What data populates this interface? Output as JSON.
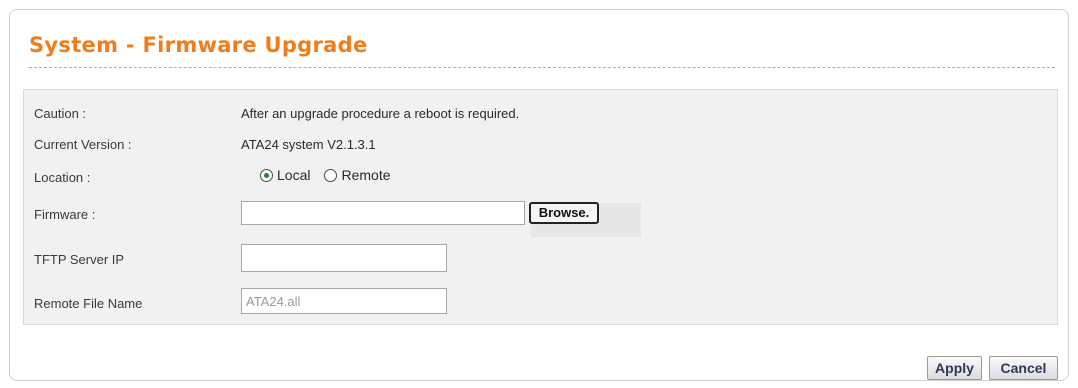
{
  "page": {
    "title": "System - Firmware Upgrade"
  },
  "form": {
    "caution_label": "Caution :",
    "caution_text": "After an upgrade procedure a reboot is required.",
    "current_version_label": "Current Version :",
    "current_version_value": "ATA24 system V2.1.3.1",
    "location_label": "Location :",
    "location_options": [
      {
        "label": "Local",
        "selected": true
      },
      {
        "label": "Remote",
        "selected": false
      }
    ],
    "firmware_label": "Firmware :",
    "firmware_value": "",
    "browse_label": "Browse.",
    "tftp_label": "TFTP Server IP",
    "tftp_value": "",
    "remote_file_label": "Remote File Name",
    "remote_file_value": "ATA24.all"
  },
  "actions": {
    "apply_label": "Apply",
    "cancel_label": "Cancel"
  },
  "colors": {
    "title": "#f07d1c",
    "title_rule": "#e7b200",
    "form_background": "#f1f1f1",
    "radio_selected_dot": "#2f7d32",
    "button_text": "#2b3a57"
  }
}
